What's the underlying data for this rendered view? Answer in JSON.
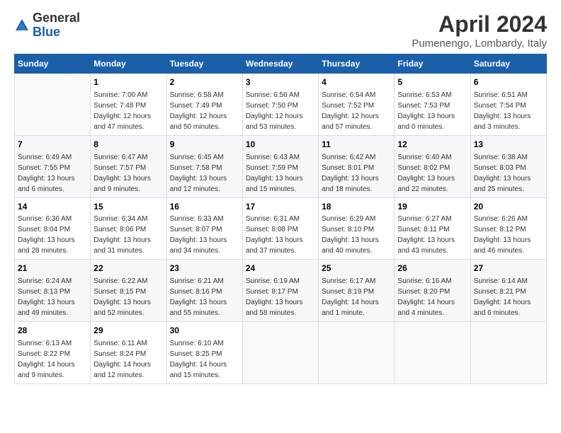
{
  "logo": {
    "general": "General",
    "blue": "Blue"
  },
  "header": {
    "title": "April 2024",
    "location": "Pumenengo, Lombardy, Italy"
  },
  "weekdays": [
    "Sunday",
    "Monday",
    "Tuesday",
    "Wednesday",
    "Thursday",
    "Friday",
    "Saturday"
  ],
  "weeks": [
    [
      {
        "day": "",
        "info": ""
      },
      {
        "day": "1",
        "info": "Sunrise: 7:00 AM\nSunset: 7:48 PM\nDaylight: 12 hours\nand 47 minutes."
      },
      {
        "day": "2",
        "info": "Sunrise: 6:58 AM\nSunset: 7:49 PM\nDaylight: 12 hours\nand 50 minutes."
      },
      {
        "day": "3",
        "info": "Sunrise: 6:56 AM\nSunset: 7:50 PM\nDaylight: 12 hours\nand 53 minutes."
      },
      {
        "day": "4",
        "info": "Sunrise: 6:54 AM\nSunset: 7:52 PM\nDaylight: 12 hours\nand 57 minutes."
      },
      {
        "day": "5",
        "info": "Sunrise: 6:53 AM\nSunset: 7:53 PM\nDaylight: 13 hours\nand 0 minutes."
      },
      {
        "day": "6",
        "info": "Sunrise: 6:51 AM\nSunset: 7:54 PM\nDaylight: 13 hours\nand 3 minutes."
      }
    ],
    [
      {
        "day": "7",
        "info": "Sunrise: 6:49 AM\nSunset: 7:55 PM\nDaylight: 13 hours\nand 6 minutes."
      },
      {
        "day": "8",
        "info": "Sunrise: 6:47 AM\nSunset: 7:57 PM\nDaylight: 13 hours\nand 9 minutes."
      },
      {
        "day": "9",
        "info": "Sunrise: 6:45 AM\nSunset: 7:58 PM\nDaylight: 13 hours\nand 12 minutes."
      },
      {
        "day": "10",
        "info": "Sunrise: 6:43 AM\nSunset: 7:59 PM\nDaylight: 13 hours\nand 15 minutes."
      },
      {
        "day": "11",
        "info": "Sunrise: 6:42 AM\nSunset: 8:01 PM\nDaylight: 13 hours\nand 18 minutes."
      },
      {
        "day": "12",
        "info": "Sunrise: 6:40 AM\nSunset: 8:02 PM\nDaylight: 13 hours\nand 22 minutes."
      },
      {
        "day": "13",
        "info": "Sunrise: 6:38 AM\nSunset: 8:03 PM\nDaylight: 13 hours\nand 25 minutes."
      }
    ],
    [
      {
        "day": "14",
        "info": "Sunrise: 6:36 AM\nSunset: 8:04 PM\nDaylight: 13 hours\nand 28 minutes."
      },
      {
        "day": "15",
        "info": "Sunrise: 6:34 AM\nSunset: 8:06 PM\nDaylight: 13 hours\nand 31 minutes."
      },
      {
        "day": "16",
        "info": "Sunrise: 6:33 AM\nSunset: 8:07 PM\nDaylight: 13 hours\nand 34 minutes."
      },
      {
        "day": "17",
        "info": "Sunrise: 6:31 AM\nSunset: 8:08 PM\nDaylight: 13 hours\nand 37 minutes."
      },
      {
        "day": "18",
        "info": "Sunrise: 6:29 AM\nSunset: 8:10 PM\nDaylight: 13 hours\nand 40 minutes."
      },
      {
        "day": "19",
        "info": "Sunrise: 6:27 AM\nSunset: 8:11 PM\nDaylight: 13 hours\nand 43 minutes."
      },
      {
        "day": "20",
        "info": "Sunrise: 6:26 AM\nSunset: 8:12 PM\nDaylight: 13 hours\nand 46 minutes."
      }
    ],
    [
      {
        "day": "21",
        "info": "Sunrise: 6:24 AM\nSunset: 8:13 PM\nDaylight: 13 hours\nand 49 minutes."
      },
      {
        "day": "22",
        "info": "Sunrise: 6:22 AM\nSunset: 8:15 PM\nDaylight: 13 hours\nand 52 minutes."
      },
      {
        "day": "23",
        "info": "Sunrise: 6:21 AM\nSunset: 8:16 PM\nDaylight: 13 hours\nand 55 minutes."
      },
      {
        "day": "24",
        "info": "Sunrise: 6:19 AM\nSunset: 8:17 PM\nDaylight: 13 hours\nand 58 minutes."
      },
      {
        "day": "25",
        "info": "Sunrise: 6:17 AM\nSunset: 8:19 PM\nDaylight: 14 hours\nand 1 minute."
      },
      {
        "day": "26",
        "info": "Sunrise: 6:16 AM\nSunset: 8:20 PM\nDaylight: 14 hours\nand 4 minutes."
      },
      {
        "day": "27",
        "info": "Sunrise: 6:14 AM\nSunset: 8:21 PM\nDaylight: 14 hours\nand 6 minutes."
      }
    ],
    [
      {
        "day": "28",
        "info": "Sunrise: 6:13 AM\nSunset: 8:22 PM\nDaylight: 14 hours\nand 9 minutes."
      },
      {
        "day": "29",
        "info": "Sunrise: 6:11 AM\nSunset: 8:24 PM\nDaylight: 14 hours\nand 12 minutes."
      },
      {
        "day": "30",
        "info": "Sunrise: 6:10 AM\nSunset: 8:25 PM\nDaylight: 14 hours\nand 15 minutes."
      },
      {
        "day": "",
        "info": ""
      },
      {
        "day": "",
        "info": ""
      },
      {
        "day": "",
        "info": ""
      },
      {
        "day": "",
        "info": ""
      }
    ]
  ]
}
